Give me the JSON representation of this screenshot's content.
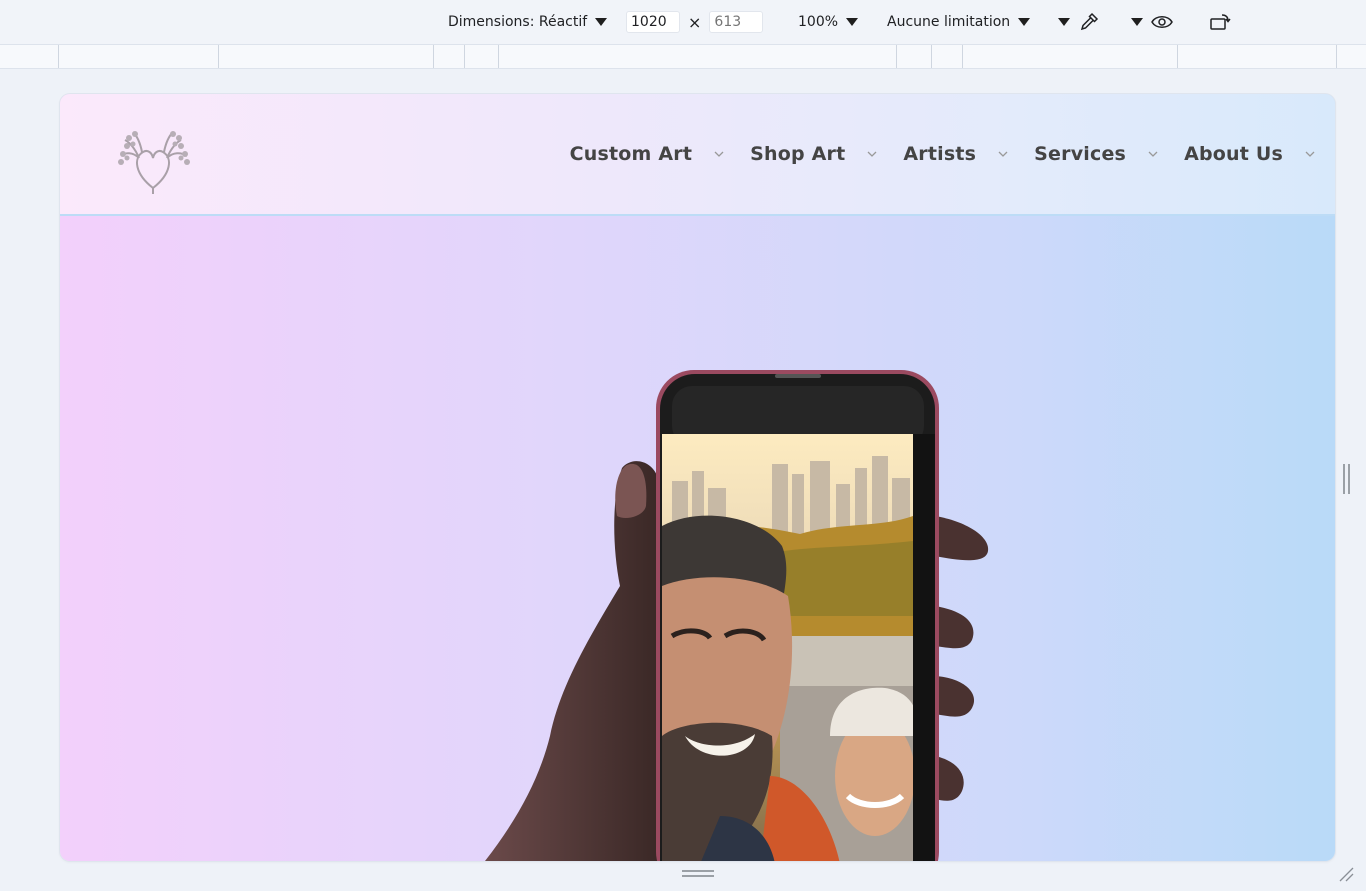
{
  "devtools": {
    "dimensions_label": "Dimensions: Réactif",
    "width_value": "1020",
    "height_placeholder": "613",
    "times_sign": "×",
    "zoom_label": "100%",
    "throttle_label": "Aucune limitation"
  },
  "site": {
    "nav": [
      {
        "label": "Custom Art"
      },
      {
        "label": "Shop Art"
      },
      {
        "label": "Artists"
      },
      {
        "label": "Services"
      },
      {
        "label": "About Us"
      }
    ]
  },
  "colors": {
    "phone_frame": "#9b4a60",
    "gradient_left": "#f3d0fb",
    "gradient_right": "#b9daf8",
    "nav_text": "#444444"
  }
}
